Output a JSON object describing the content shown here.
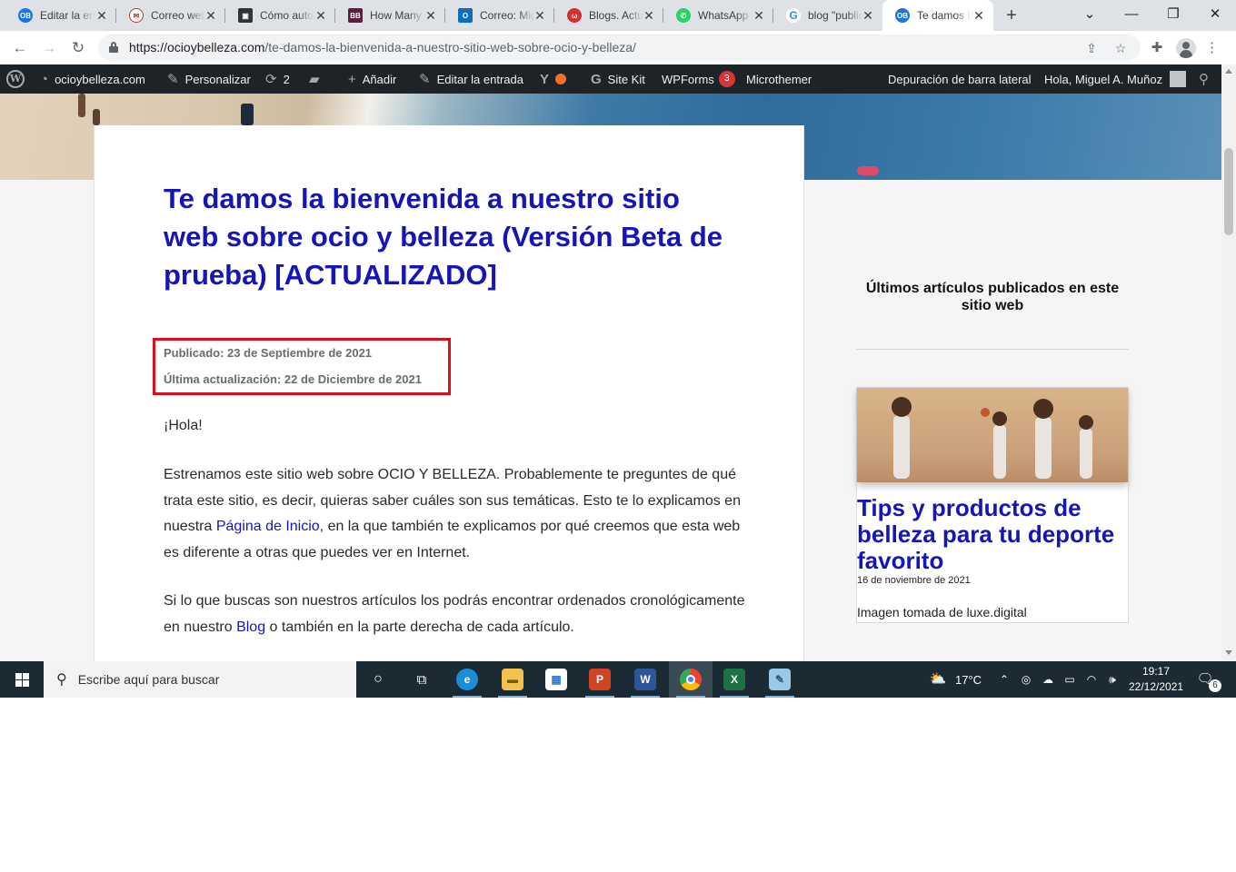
{
  "browser": {
    "tabs": [
      {
        "title": "Editar la entrada",
        "icon": "ocioybelleza-favicon",
        "color": "#1a73e8"
      },
      {
        "title": "Correo web",
        "icon": "mail-favicon",
        "color": "#c0392b"
      },
      {
        "title": "Cómo automatizar",
        "icon": "blog-favicon",
        "color": "#333333"
      },
      {
        "title": "How Many",
        "icon": "bb-favicon",
        "color": "#5b1f3d"
      },
      {
        "title": "Correo: Miguel",
        "icon": "outlook-favicon",
        "color": "#0f6cbd"
      },
      {
        "title": "Blogs. Actualidad",
        "icon": "blogs-favicon",
        "color": "#d32f2f"
      },
      {
        "title": "WhatsApp",
        "icon": "whatsapp-favicon",
        "color": "#25d366"
      },
      {
        "title": "blog \"publicado\"",
        "icon": "google-favicon",
        "color": "#4285f4"
      },
      {
        "title": "Te damos la bienvenida",
        "icon": "ocioybelleza-favicon",
        "color": "#1a73e8"
      }
    ],
    "active_tab": 8,
    "url_host": "https://ocioybelleza.com",
    "url_path": "/te-damos-la-bienvenida-a-nuestro-sitio-web-sobre-ocio-y-belleza/"
  },
  "adminbar": {
    "site": "ocioybelleza.com",
    "customize": "Personalizar",
    "updates_count": "2",
    "add_new": "Añadir",
    "edit_post": "Editar la entrada",
    "site_kit": "Site Kit",
    "wpforms": "WPForms",
    "wpforms_badge": "3",
    "microthemer": "Microthemer",
    "sidebar_debug": "Depuración de barra lateral",
    "greeting": "Hola, Miguel A. Muñoz"
  },
  "article": {
    "title": "Te damos la bienvenida a nuestro sitio web sobre ocio y belleza (Versión Beta de prueba) [ACTUALIZADO]",
    "published": "Publicado: 23 de Septiembre de 2021",
    "updated": "Última actualización: 22 de Diciembre de 2021",
    "greeting": "¡Hola!",
    "p1_a": "Estrenamos este sitio web sobre OCIO Y BELLEZA. Probablemente te preguntes de qué trata este sitio, es decir, quieras saber cuáles son sus temáticas. Esto te lo explicamos en nuestra ",
    "p1_link": "Página de Inicio",
    "p1_b": ", en la que también te explicamos por qué creemos que esta web es diferente a otras que puedes ver en Internet.",
    "p2_a": "Si lo que buscas son nuestros artículos los podrás encontrar ordenados cronológicamente en nuestro ",
    "p2_link": "Blog",
    "p2_b": " o también en la parte derecha de cada artículo."
  },
  "sidebar": {
    "heading": "Últimos artículos publicados en este sitio web",
    "card_title": "Tips y productos de belleza para tu deporte favorito",
    "card_date": "16 de noviembre de 2021",
    "card_caption": "Imagen tomada de luxe.digital"
  },
  "taskbar": {
    "search_placeholder": "Escribe aquí para buscar",
    "weather": "17°C",
    "time": "19:17",
    "date": "22/12/2021",
    "notifications": "6"
  },
  "colors": {
    "link": "#1515b8",
    "highlight_border": "#d7111b",
    "adminbar": "#1d2327",
    "taskbar": "#1c2b33"
  }
}
